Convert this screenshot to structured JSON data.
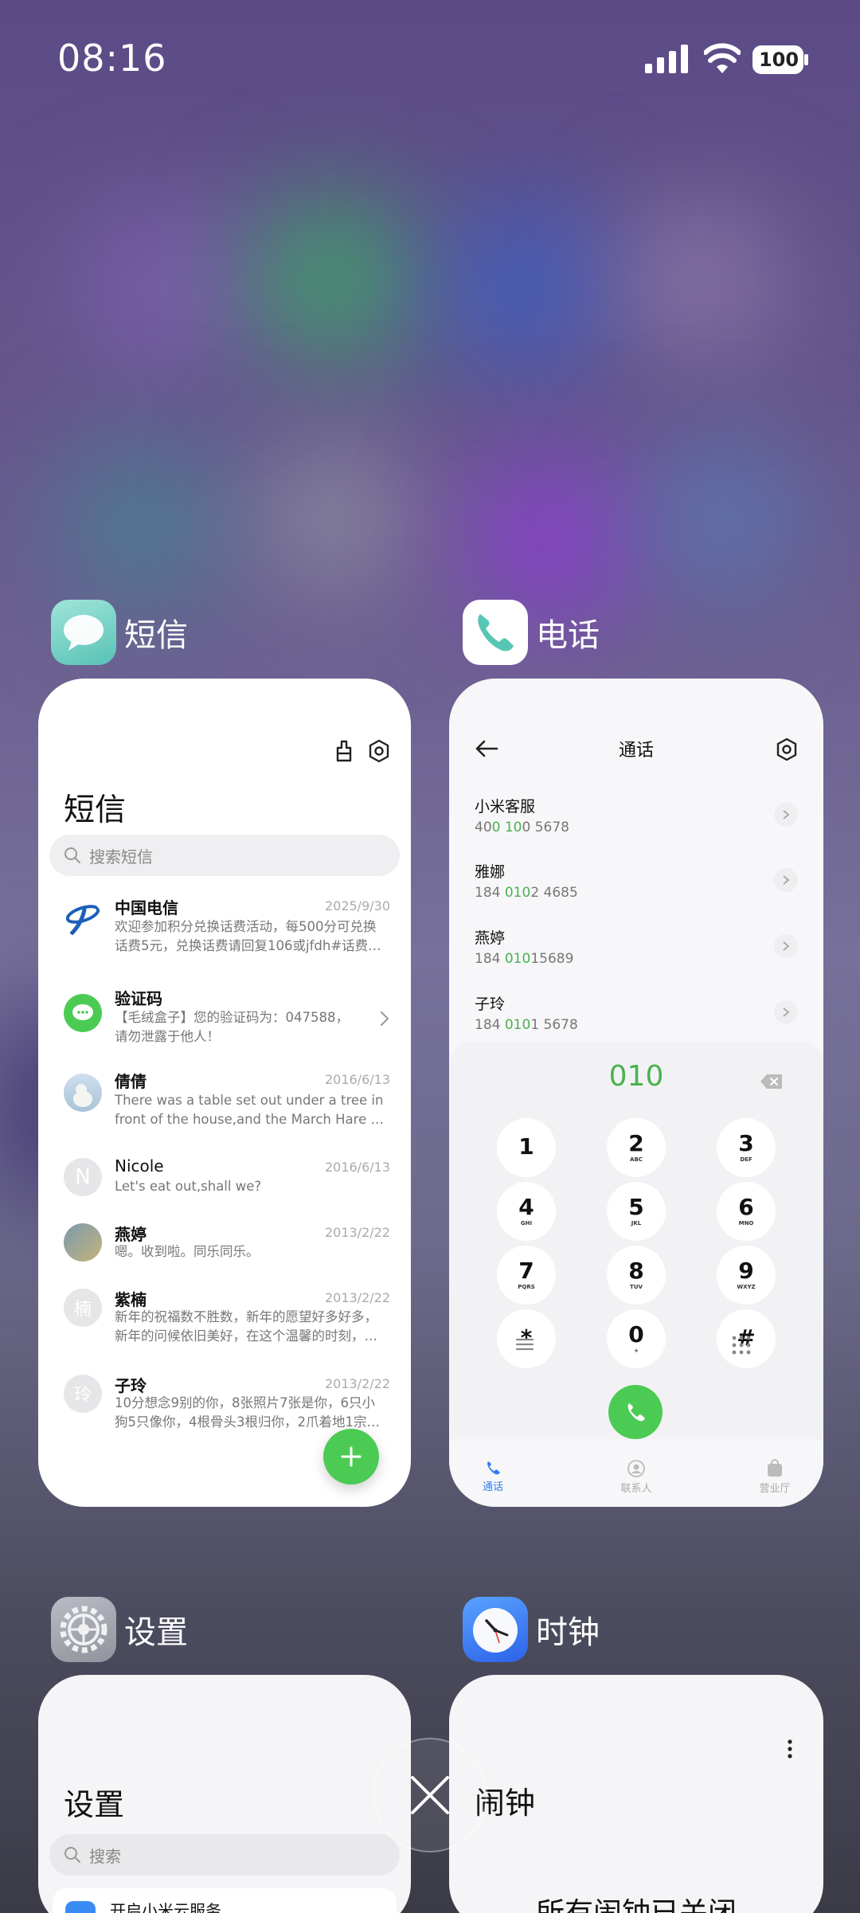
{
  "status_bar": {
    "time": "08:16",
    "battery": "100"
  },
  "apps": {
    "sms": {
      "name": "短信"
    },
    "phone": {
      "name": "电话"
    },
    "settings": {
      "name": "设置"
    },
    "clock": {
      "name": "时钟"
    }
  },
  "sms_card": {
    "title": "短信",
    "search_placeholder": "搜索短信",
    "messages": [
      {
        "name": "中国电信",
        "date": "2025/9/30",
        "lines": [
          "欢迎参加积分兑换话费活动，每500分可兑换",
          "话费5元，兑换话费请回复106或jfdh#话费…"
        ]
      },
      {
        "name": "验证码",
        "date": "",
        "lines": [
          "【毛绒盒子】您的验证码为：047588，",
          "请勿泄露于他人！"
        ]
      },
      {
        "name": "倩倩",
        "date": "2016/6/13",
        "lines": [
          "There was a table set out under a tree in",
          "front of the house,and the March Hare an…"
        ]
      },
      {
        "name": "Nicole",
        "date": "2016/6/13",
        "avatar_letter": "N",
        "lines": [
          "Let's eat out,shall we?"
        ]
      },
      {
        "name": "燕婷",
        "date": "2013/2/22",
        "lines": [
          "嗯。收到啦。同乐同乐。"
        ]
      },
      {
        "name": "紫楠",
        "date": "2013/2/22",
        "avatar_letter": "楠",
        "lines": [
          "新年的祝福数不胜数，新年的愿望好多好多，",
          "新年的问候依旧美好，在这个温馨的时刻，…"
        ]
      },
      {
        "name": "子玲",
        "date": "2013/2/22",
        "avatar_letter": "玲",
        "lines": [
          "10分想念9别的你，8张照片7张是你，6只小",
          "狗5只像你，4根骨头3根归你，2爪着地1宗…"
        ]
      }
    ]
  },
  "phone_card": {
    "title": "通话",
    "contacts": [
      {
        "name": "小米客服",
        "num_a": "40",
        "num_hl": "0 10",
        "num_b": "0 5678"
      },
      {
        "name": "雅娜",
        "num_a": "184 ",
        "num_hl": "010",
        "num_b": "2 4685"
      },
      {
        "name": "燕婷",
        "num_a": "184 ",
        "num_hl": "010",
        "num_b": "15689"
      },
      {
        "name": "子玲",
        "num_a": "184 ",
        "num_hl": "010",
        "num_b": "1 5678"
      }
    ],
    "dialed": "010",
    "keys": [
      {
        "d": "1",
        "l": ""
      },
      {
        "d": "2",
        "l": "ABC"
      },
      {
        "d": "3",
        "l": "DEF"
      },
      {
        "d": "4",
        "l": "GHI"
      },
      {
        "d": "5",
        "l": "JKL"
      },
      {
        "d": "6",
        "l": "MNO"
      },
      {
        "d": "7",
        "l": "PQRS"
      },
      {
        "d": "8",
        "l": "TUV"
      },
      {
        "d": "9",
        "l": "WXYZ"
      },
      {
        "d": "*",
        "l": ""
      },
      {
        "d": "0",
        "l": "+"
      },
      {
        "d": "#",
        "l": ""
      }
    ],
    "tabs": [
      "通话",
      "联系人",
      "营业厅"
    ]
  },
  "settings_card": {
    "title": "设置",
    "search_placeholder": "搜索",
    "first_item": "开启小米云服务"
  },
  "clock_card": {
    "title": "闹钟",
    "empty_text": "所有闹钟已关闭"
  },
  "colors": {
    "accent_green": "#4ccb54",
    "accent_blue": "#2e7cf6"
  }
}
